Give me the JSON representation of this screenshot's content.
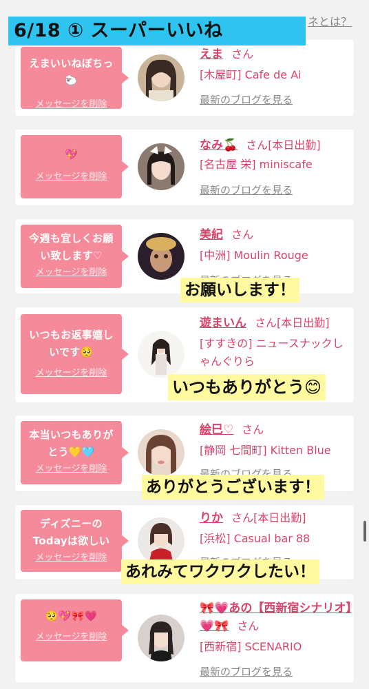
{
  "header": {
    "title": "6/18 ① スーパーいいね",
    "partial_link": "ネとは？"
  },
  "entries": [
    {
      "message": "えまいいねぼちっ🐑",
      "delete_label": "メッセージを削除",
      "name": "えま",
      "honorific": "さん",
      "status": "",
      "shop": "[木屋町] Cafe de Ai",
      "blog_label": "最新のブログを見る",
      "avatar_icon": "profile-photo"
    },
    {
      "message": "💖",
      "delete_label": "メッセージを削除",
      "name": "なみ🍒",
      "honorific": "さん",
      "status": "[本日出勤]",
      "shop": "[名古屋 栄] miniscafe",
      "blog_label": "最新のブログを見る",
      "avatar_icon": "profile-photo"
    },
    {
      "message": "今週も宜しくお願い致します♡",
      "delete_label": "メッセージを削除",
      "name": "美紀",
      "honorific": "さん",
      "status": "",
      "shop": "[中洲] Moulin Rouge",
      "blog_label": "最新のブログを見る",
      "avatar_icon": "profile-photo"
    },
    {
      "message": "いつもお返事嬉しいです🥺",
      "delete_label": "メッセージを削除",
      "name": "遊まいん",
      "honorific": "さん",
      "status": "[本日出勤]",
      "shop": "[すすきの] ニュースナックしゃんぐりら",
      "blog_label": "",
      "avatar_icon": "profile-photo"
    },
    {
      "message": "本当いつもありがとう💛🩵",
      "delete_label": "メッセージを削除",
      "name": "絵巳♡",
      "honorific": "さん",
      "status": "",
      "shop": "[静岡 七間町] Kitten Blue",
      "blog_label": "最新のブログを見る",
      "avatar_icon": "profile-photo"
    },
    {
      "message": "ディズニーのTodayは欲しい",
      "delete_label": "メッセージを削除",
      "name": "りか",
      "honorific": "さん",
      "status": "[本日出勤]",
      "shop": "[浜松] Casual bar 88",
      "blog_label": "最新のブログを見る",
      "avatar_icon": "profile-photo"
    },
    {
      "message": "🥺💖🎀💗",
      "delete_label": "メッセージを削除",
      "name": "🎀💗あの【西新宿シナリオ】💗🎀",
      "honorific": "さん",
      "status": "",
      "shop": "[西新宿] SCENARIO",
      "blog_label": "最新のブログを見る",
      "avatar_icon": "profile-photo"
    }
  ],
  "captions": [
    "お願いします！",
    "いつもありがとう😊",
    "ありがとうございます！",
    "あれみてワクワクしたい！"
  ],
  "colors": {
    "accent_pink": "#f58a9a",
    "name_pink": "#d9436a",
    "banner_blue": "#2ec4ef",
    "caption_yellow": "#fff9a0"
  }
}
